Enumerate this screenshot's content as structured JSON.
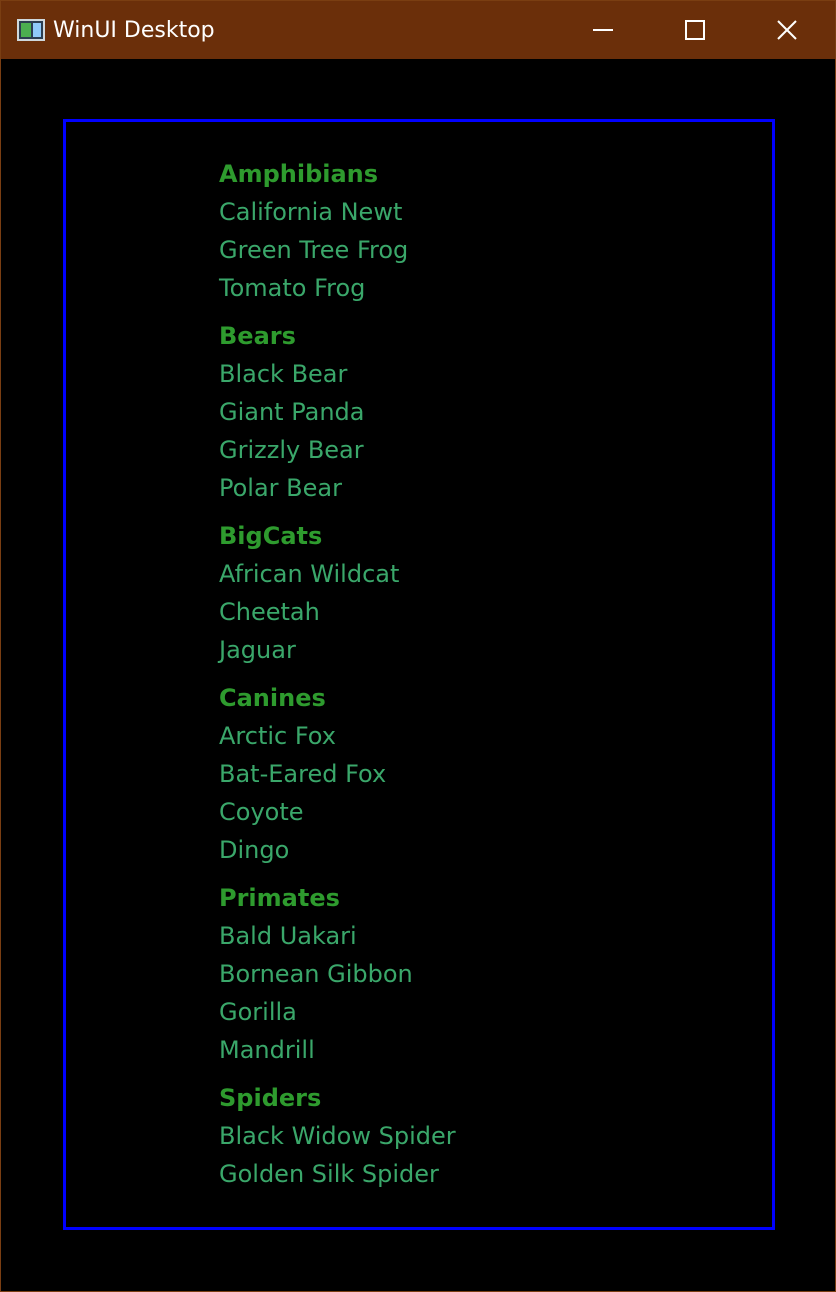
{
  "window": {
    "title": "WinUI Desktop",
    "titlebar_color": "#6b2f0a",
    "border_color": "#0000ff",
    "header_color": "#2e9b2e",
    "item_color": "#3aa76a",
    "icons": {
      "app": "app-window-icon",
      "minimize": "minimize-icon",
      "maximize": "maximize-icon",
      "close": "close-icon"
    }
  },
  "groups": [
    {
      "header": "Amphibians",
      "items": [
        "California Newt",
        "Green Tree Frog",
        "Tomato Frog"
      ]
    },
    {
      "header": "Bears",
      "items": [
        "Black Bear",
        "Giant Panda",
        "Grizzly Bear",
        "Polar Bear"
      ]
    },
    {
      "header": "BigCats",
      "items": [
        "African Wildcat",
        "Cheetah",
        "Jaguar"
      ]
    },
    {
      "header": "Canines",
      "items": [
        "Arctic Fox",
        "Bat-Eared Fox",
        "Coyote",
        "Dingo"
      ]
    },
    {
      "header": "Primates",
      "items": [
        "Bald Uakari",
        "Bornean Gibbon",
        "Gorilla",
        "Mandrill"
      ]
    },
    {
      "header": "Spiders",
      "items": [
        "Black Widow Spider",
        "Golden Silk Spider"
      ]
    }
  ]
}
